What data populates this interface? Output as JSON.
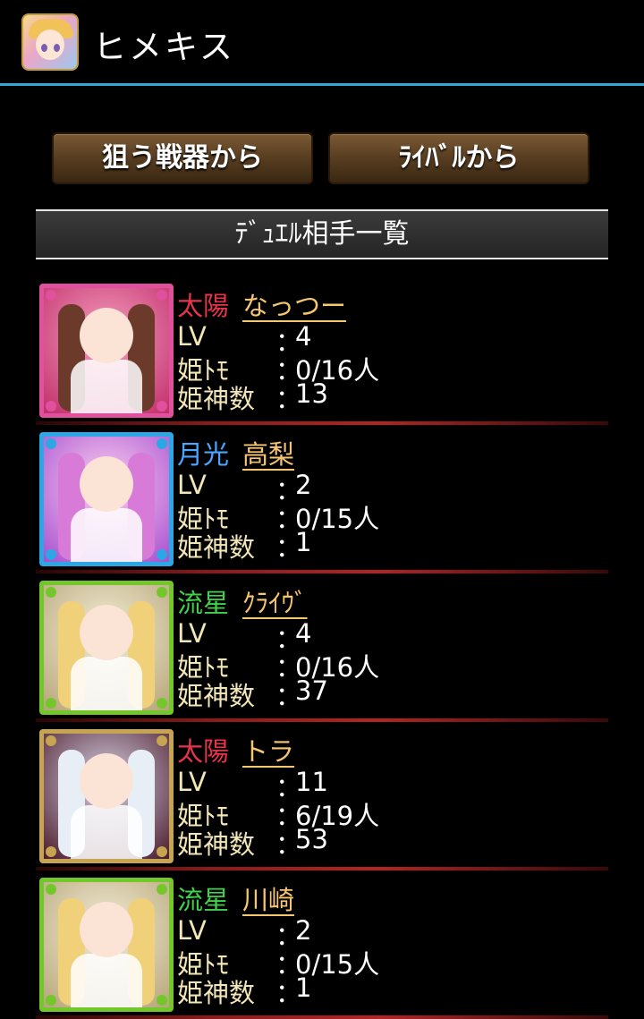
{
  "app": {
    "title": "ヒメキス"
  },
  "buttons": {
    "weapon": "狙う戦器から",
    "rival": "ﾗｲﾊﾞﾙから"
  },
  "section": {
    "title": "ﾃﾞｭｴﾙ相手一覧"
  },
  "stat_labels": {
    "lv": "LV",
    "tomo": "姫ﾄﾓ",
    "shin": "姫神数",
    "colon": "："
  },
  "colors": {
    "sun": "#e8344a",
    "moon": "#4aa6ff",
    "meteor": "#3fd24a",
    "name": "#f7c66e"
  },
  "opponents": [
    {
      "attr": "太陽",
      "attr_color": "#e8344a",
      "name": "なっつー",
      "lv": "4",
      "tomo": "0/16人",
      "shin": "13",
      "frame": "#e1509c",
      "icon": "pink-haired-girl-card-icon"
    },
    {
      "attr": "月光",
      "attr_color": "#4aa6ff",
      "name": "高梨",
      "lv": "2",
      "tomo": "0/15人",
      "shin": "1",
      "frame": "#2ba7e6",
      "icon": "purple-haired-girl-card-icon"
    },
    {
      "attr": "流星",
      "attr_color": "#3fd24a",
      "name": "ｸﾗｲｳﾞ",
      "lv": "4",
      "tomo": "0/16人",
      "shin": "37",
      "frame": "#73c72a",
      "icon": "blonde-girl-card-icon"
    },
    {
      "attr": "太陽",
      "attr_color": "#e8344a",
      "name": "トラ",
      "lv": "11",
      "tomo": "6/19人",
      "shin": "53",
      "frame": "#c7a451",
      "icon": "silver-haired-girl-card-icon"
    },
    {
      "attr": "流星",
      "attr_color": "#3fd24a",
      "name": "川崎",
      "lv": "2",
      "tomo": "0/15人",
      "shin": "1",
      "frame": "#73c72a",
      "icon": "blonde-girl-card-icon"
    }
  ]
}
